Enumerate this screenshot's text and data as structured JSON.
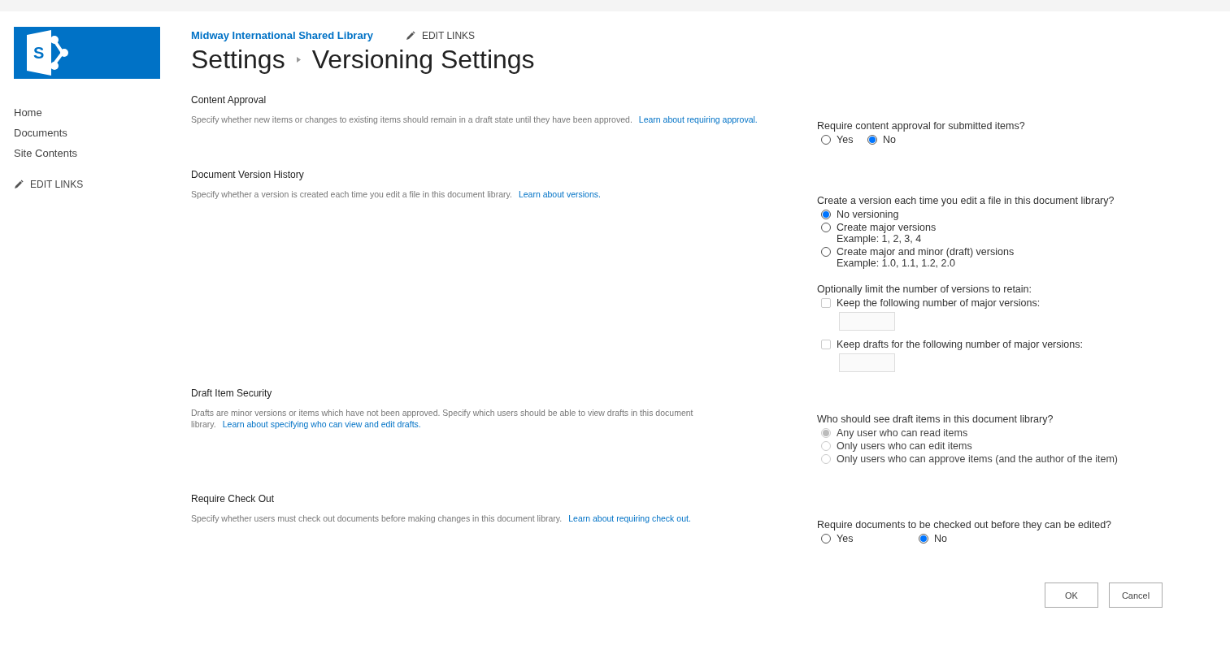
{
  "logo": {
    "letter": "S"
  },
  "site": {
    "title": "Midway International Shared Library",
    "edit_links": "EDIT LINKS"
  },
  "breadcrumb": [
    {
      "label": "Settings"
    },
    {
      "label": "Versioning Settings"
    }
  ],
  "nav": {
    "items": [
      {
        "label": "Home"
      },
      {
        "label": "Documents"
      },
      {
        "label": "Site Contents"
      }
    ],
    "edit_links": "EDIT LINKS"
  },
  "sections": [
    {
      "title": "Content Approval",
      "description": "Specify whether new items or changes to existing items should remain in a draft state until they have been approved.",
      "link": "Learn about requiring approval.",
      "groups": [
        {
          "question": "Require content approval for submitted items?",
          "kind": "inline",
          "controls": [
            {
              "kind": "radio",
              "label": "Yes",
              "selected": false,
              "disabled": false
            },
            {
              "kind": "radio",
              "label": "No",
              "selected": true,
              "disabled": false
            }
          ]
        }
      ]
    },
    {
      "title": "Document Version History",
      "description": "Specify whether a version is created each time you edit a file in this document library.",
      "link": "Learn about versions.",
      "groups": [
        {
          "question": "Create a version each time you edit a file in this document library?",
          "kind": "stacked",
          "controls": [
            {
              "kind": "radio",
              "label": "No versioning",
              "selected": true,
              "disabled": false
            },
            {
              "kind": "radio",
              "label": "Create major versions",
              "example": "Example: 1, 2, 3, 4",
              "selected": false,
              "disabled": false
            },
            {
              "kind": "radio",
              "label": "Create major and minor (draft) versions",
              "example": "Example: 1.0, 1.1, 1.2, 2.0",
              "selected": false,
              "disabled": false
            }
          ]
        },
        {
          "question": "Optionally limit the number of versions to retain:",
          "kind": "stacked",
          "controls": [
            {
              "kind": "checkbox",
              "label": "Keep the following number of major versions:",
              "checked": false,
              "disabled": true
            },
            {
              "kind": "checkbox",
              "label": "Keep drafts for the following number of major versions:",
              "checked": false,
              "disabled": true
            }
          ]
        }
      ]
    },
    {
      "title": "Draft Item Security",
      "description": "Drafts are minor versions or items which have not been approved. Specify which users should be able to view drafts in this document library.",
      "link": "Learn about specifying who can view and edit drafts.",
      "groups": [
        {
          "question": "Who should see draft items in this document library?",
          "kind": "stacked",
          "controls": [
            {
              "kind": "radio",
              "label": "Any user who can read items",
              "selected": true,
              "disabled": true
            },
            {
              "kind": "radio",
              "label": "Only users who can edit items",
              "selected": false,
              "disabled": true
            },
            {
              "kind": "radio",
              "label": "Only users who can approve items (and the author of the item)",
              "selected": false,
              "disabled": true
            }
          ]
        }
      ]
    },
    {
      "title": "Require Check Out",
      "description": "Specify whether users must check out documents before making changes in this document library.",
      "link": "Learn about requiring check out.",
      "groups": [
        {
          "question": "Require documents to be checked out before they can be edited?",
          "kind": "wide",
          "controls": [
            {
              "kind": "radio",
              "label": "Yes",
              "selected": false,
              "disabled": false
            },
            {
              "kind": "radio",
              "label": "No",
              "selected": true,
              "disabled": false
            }
          ]
        }
      ]
    }
  ],
  "buttons": [
    {
      "label": "OK"
    },
    {
      "label": "Cancel"
    }
  ]
}
